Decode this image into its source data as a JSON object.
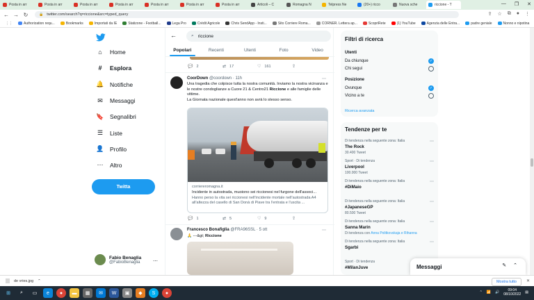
{
  "browser": {
    "tabs": [
      {
        "label": "Posta in arr",
        "color": "#d93025"
      },
      {
        "label": "Posta in arr",
        "color": "#d93025"
      },
      {
        "label": "Posta in arr",
        "color": "#d93025"
      },
      {
        "label": "Posta in arr",
        "color": "#d93025"
      },
      {
        "label": "Posta in arr",
        "color": "#d93025"
      },
      {
        "label": "Posta in arr",
        "color": "#d93025"
      },
      {
        "label": "Posta in arr",
        "color": "#d93025"
      },
      {
        "label": "Articoli – C",
        "color": "#444444"
      },
      {
        "label": "Romagna N",
        "color": "#555555"
      },
      {
        "label": "Telpress Ne",
        "color": "#f5b400"
      },
      {
        "label": "(20+) ricco",
        "color": "#1877f2"
      },
      {
        "label": "Nuova sche",
        "color": "#777777"
      },
      {
        "label": "riccione - T",
        "color": "#1d9bf0",
        "active": true
      }
    ],
    "url": "twitter.com/search?q=riccione&src=typed_query",
    "bookmarks": [
      {
        "label": "Authorization requ...",
        "color": "#4285f4"
      },
      {
        "label": "Bookmarks",
        "color": "#f5b400"
      },
      {
        "label": "Importati da IE",
        "color": "#f5b400"
      },
      {
        "label": "Statizone - Football...",
        "color": "#2e7d32"
      },
      {
        "label": "Lega Pro",
        "color": "#1e3a8a"
      },
      {
        "label": "Crédit Agricole",
        "color": "#007a5e"
      },
      {
        "label": "Chris SendApp - Insti...",
        "color": "#333333"
      },
      {
        "label": "Sito Corriere Roma...",
        "color": "#777777"
      },
      {
        "label": "CORNER. Lettera ap...",
        "color": "#999999"
      },
      {
        "label": "ScopriRete",
        "color": "#e53935"
      },
      {
        "label": "(1) YouTube",
        "color": "#ff0000"
      },
      {
        "label": "Agenzia delle Entra...",
        "color": "#0d47a1"
      },
      {
        "label": "padre geniale",
        "color": "#1d9bf0"
      },
      {
        "label": "Nonno e nipotina",
        "color": "#1d9bf0"
      }
    ]
  },
  "sidebar": {
    "items": [
      {
        "label": "Home",
        "icon": "home-icon",
        "glyph": "⌂"
      },
      {
        "label": "Esplora",
        "icon": "hashtag-icon",
        "glyph": "#",
        "bold": true
      },
      {
        "label": "Notifiche",
        "icon": "bell-icon",
        "glyph": "🔔"
      },
      {
        "label": "Messaggi",
        "icon": "mail-icon",
        "glyph": "✉"
      },
      {
        "label": "Segnalibri",
        "icon": "bookmark-icon",
        "glyph": "🔖"
      },
      {
        "label": "Liste",
        "icon": "list-icon",
        "glyph": "☰"
      },
      {
        "label": "Profilo",
        "icon": "user-icon",
        "glyph": "👤"
      },
      {
        "label": "Altro",
        "icon": "more-icon",
        "glyph": "⋯"
      }
    ],
    "tweet_button": "Twitta",
    "profile": {
      "name": "Fabio Benaglia",
      "handle": "@FabioBenaglia"
    }
  },
  "search": {
    "value": "riccione",
    "tabs": [
      "Popolari",
      "Recenti",
      "Utenti",
      "Foto",
      "Video"
    ],
    "active_tab": 0
  },
  "prev_actions": {
    "replies": "2",
    "retweets": "17",
    "likes": "161"
  },
  "tweet1": {
    "name": "CoorDown",
    "handle": "@coordown · 11h",
    "text_parts": [
      "Una tragedia che colpisce tutta la nostra comunità. Inviamo la nostra vicinanza e le nostre condoglianze a Cuore 21 & Centro21 ",
      "Riccione",
      " e alle famiglie delle vittime."
    ],
    "text2": "La Giornata nazionale quest'anno non avrà lo stesso senso.",
    "card": {
      "domain": "corriereromagna.it",
      "title": "Incidente in autostrada, muoiono sei riccionesi nel furgone dell'associ...",
      "desc": "Hanno perso la vita sei riccionesi nell'incidente mortale nell'autostrada A4 all'altezza del casello di San Donà di Piave tra l'entrata e l'uscita ..."
    },
    "actions": {
      "replies": "1",
      "retweets": "5",
      "likes": "9"
    }
  },
  "tweet2": {
    "name": "Francesco Bonafiglia",
    "handle": "@FRA96SSL · 5 ott",
    "text_prefix": "🙏 ---&gt; ",
    "text_highlight": "Riccione"
  },
  "filters": {
    "title": "Filtri di ricerca",
    "users_label": "Utenti",
    "users_options": [
      {
        "label": "Da chiunque",
        "checked": true
      },
      {
        "label": "Chi segui",
        "checked": false
      }
    ],
    "location_label": "Posizione",
    "location_options": [
      {
        "label": "Ovunque",
        "checked": true
      },
      {
        "label": "Vicino a te",
        "checked": false
      }
    ],
    "advanced": "Ricerca avanzata"
  },
  "trends": {
    "title": "Tendenze per te",
    "items": [
      {
        "category": "Di tendenza nella seguente zona: Italia",
        "name": "The Rock",
        "count": "30.400 Tweet"
      },
      {
        "category": "Sport · Di tendenza",
        "name": "Liverpool",
        "count": "100.000 Tweet"
      },
      {
        "category": "Di tendenza nella seguente zona: Italia",
        "name": "#DiMaio",
        "count": ""
      },
      {
        "category": "Di tendenza nella seguente zona: Italia",
        "name": "#JapaneseGP",
        "count": "80.500 Tweet"
      },
      {
        "category": "Di tendenza nella seguente zona: Italia",
        "name": "Sanna Marin",
        "count": "",
        "with": "Di tendenza con ",
        "with_link": "Anna Politkovskaja e Rihanna"
      },
      {
        "category": "Di tendenza nella seguente zona: Italia",
        "name": "Sgarbi",
        "count": ""
      },
      {
        "category": "Sport · Di tendenza",
        "name": "#MilanJuve",
        "count": ""
      }
    ]
  },
  "messages": {
    "label": "Messaggi"
  },
  "download": {
    "file": "de vries.jpg",
    "show_all": "Mostra tutto"
  },
  "taskbar": {
    "time": "09:04",
    "date": "08/10/2022"
  }
}
